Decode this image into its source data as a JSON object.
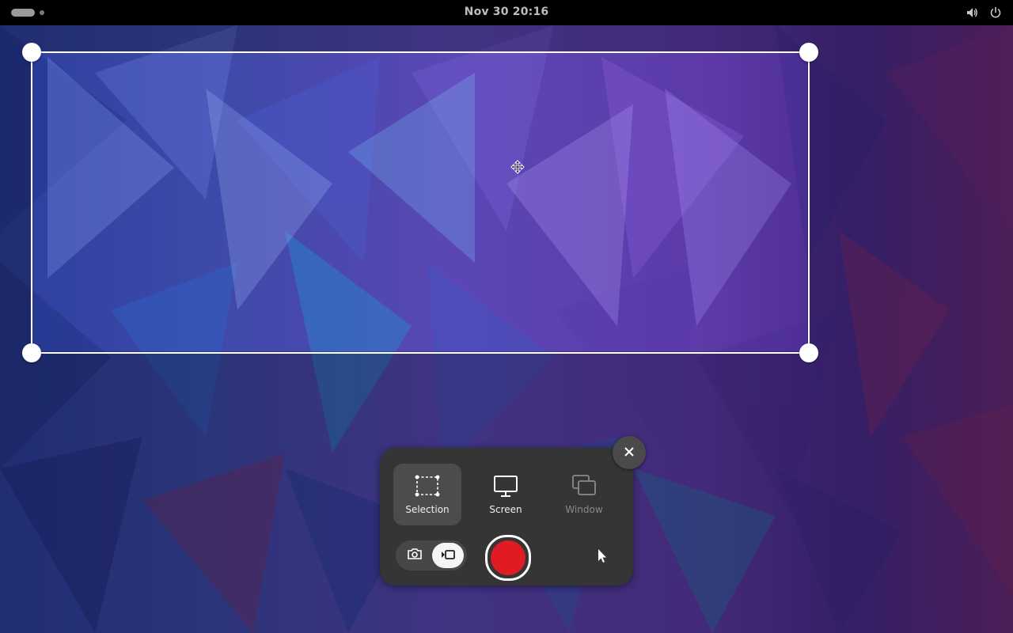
{
  "topbar": {
    "clock": "Nov 30  20:16",
    "icons": [
      "activities-indicator",
      "volume-icon",
      "power-icon"
    ]
  },
  "screenshot_ui": {
    "modes": [
      {
        "label": "Selection",
        "icon": "selection-icon",
        "state": "selected"
      },
      {
        "label": "Screen",
        "icon": "monitor-icon",
        "state": "normal"
      },
      {
        "label": "Window",
        "icon": "window-icon",
        "state": "disabled"
      }
    ],
    "capture_type": {
      "options": [
        "screenshot",
        "screencast"
      ],
      "selected": "screencast"
    },
    "record_color": "#e01b24",
    "show_pointer_icon": "pointer-icon",
    "close_icon": "close-icon"
  },
  "colors": {
    "panel": "#353535",
    "topbar": "#000000",
    "selection_border": "#ffffff"
  }
}
